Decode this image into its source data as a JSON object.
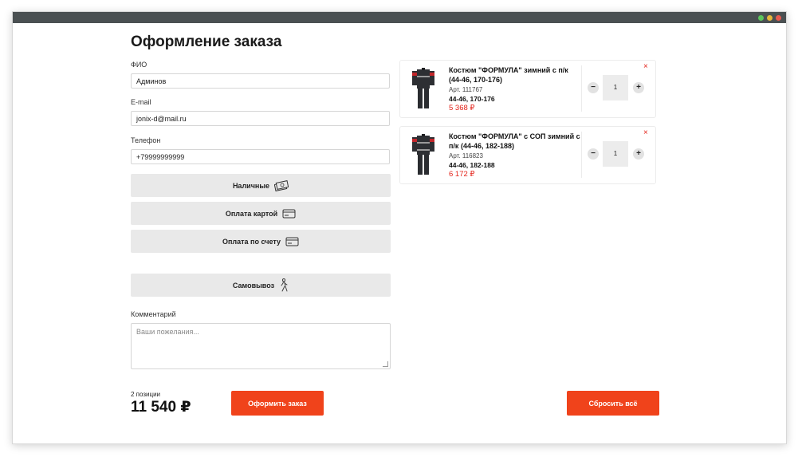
{
  "page": {
    "title": "Оформление заказа"
  },
  "form": {
    "fio": {
      "label": "ФИО",
      "value": "Админов"
    },
    "email": {
      "label": "E-mail",
      "value": "jonix-d@mail.ru"
    },
    "phone": {
      "label": "Телефон",
      "value": "+79999999999"
    },
    "payment": [
      {
        "label": "Наличные",
        "icon": "cash-icon"
      },
      {
        "label": "Оплата картой",
        "icon": "card-icon"
      },
      {
        "label": "Оплата по счету",
        "icon": "card-icon"
      }
    ],
    "delivery": {
      "label": "Самовывоз",
      "icon": "walking-person-icon"
    },
    "comment": {
      "label": "Комментарий",
      "placeholder": "Ваши пожелания..."
    }
  },
  "cart": {
    "items": [
      {
        "name": "Костюм \"ФОРМУЛА\" зимний с п/к (44-46, 170-176)",
        "sku": "Арт. 111767",
        "size": "44-46, 170-176",
        "price": "5 368 ₽",
        "qty": "1"
      },
      {
        "name": "Костюм \"ФОРМУЛА\" с СОП зимний с п/к (44-46, 182-188)",
        "sku": "Арт. 116823",
        "size": "44-46, 182-188",
        "price": "6 172 ₽",
        "qty": "1"
      }
    ],
    "qty_minus": "−",
    "qty_plus": "+",
    "remove": "×"
  },
  "summary": {
    "count": "2 позиции",
    "total": "11 540 ₽",
    "submit_label": "Оформить заказ",
    "reset_label": "Сбросить всё"
  },
  "colors": {
    "accent": "#f0431b",
    "price": "#e3241b",
    "titlebar": "#4a5052"
  }
}
